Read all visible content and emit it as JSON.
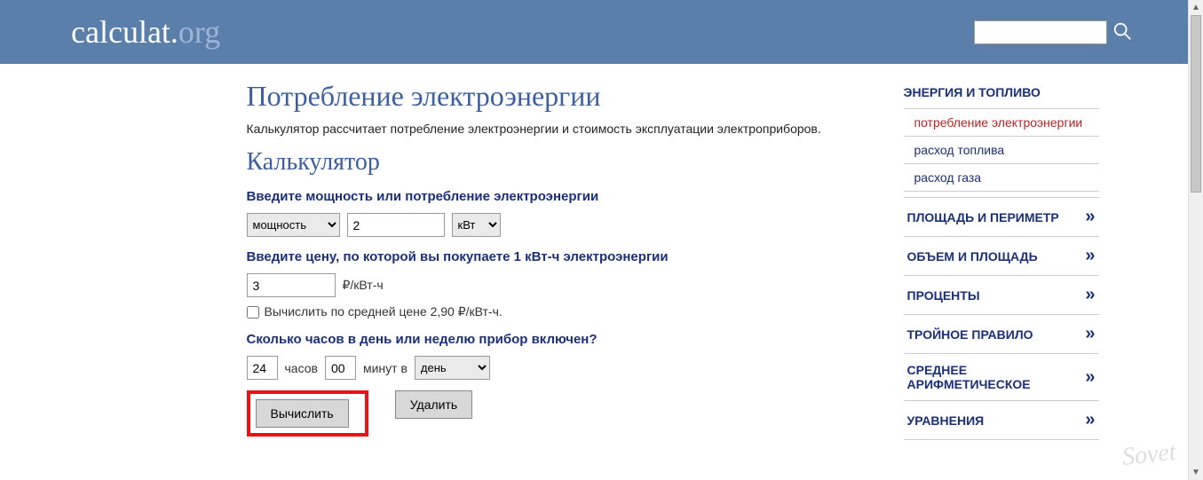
{
  "header": {
    "logo_main": "calculat",
    "logo_dot": ".",
    "logo_org": "org"
  },
  "page": {
    "title": "Потребление электроэнергии",
    "description": "Калькулятор рассчитает потребление электроэнергии и стоимость эксплуатации электроприборов.",
    "calc_heading": "Калькулятор"
  },
  "form": {
    "power_label": "Введите мощность или потребление электроэнергии",
    "mode_value": "мощность",
    "power_value": "2",
    "unit_value": "кВт",
    "price_label": "Введите цену, по которой вы покупаете 1 кВт-ч электроэнергии",
    "price_value": "3",
    "price_unit": "₽/кВт-ч",
    "avg_checkbox": "Вычислить по средней цене 2,90 ₽/кВт-ч.",
    "hours_label": "Сколько часов в день или неделю прибор включен?",
    "hours_value": "24",
    "hours_unit": "часов",
    "minutes_value": "00",
    "minutes_unit": "минут в",
    "period_value": "день",
    "calc_button": "Вычислить",
    "clear_button": "Удалить"
  },
  "sidebar": {
    "cat_title": "ЭНЕРГИЯ И ТОПЛИВО",
    "items": [
      {
        "label": "потребление электроэнергии",
        "active": true
      },
      {
        "label": "расход топлива",
        "active": false
      },
      {
        "label": "расход газа",
        "active": false
      }
    ],
    "cats": [
      {
        "label": "ПЛОЩАДЬ И ПЕРИМЕТР"
      },
      {
        "label": "ОБЪЕМ И ПЛОЩАДЬ"
      },
      {
        "label": "ПРОЦЕНТЫ"
      },
      {
        "label": "ТРОЙНОЕ ПРАВИЛО"
      },
      {
        "label": "СРЕДНЕЕ АРИФМЕТИЧЕСКОЕ"
      },
      {
        "label": "УРАВНЕНИЯ"
      }
    ]
  },
  "watermark": "Sovet"
}
